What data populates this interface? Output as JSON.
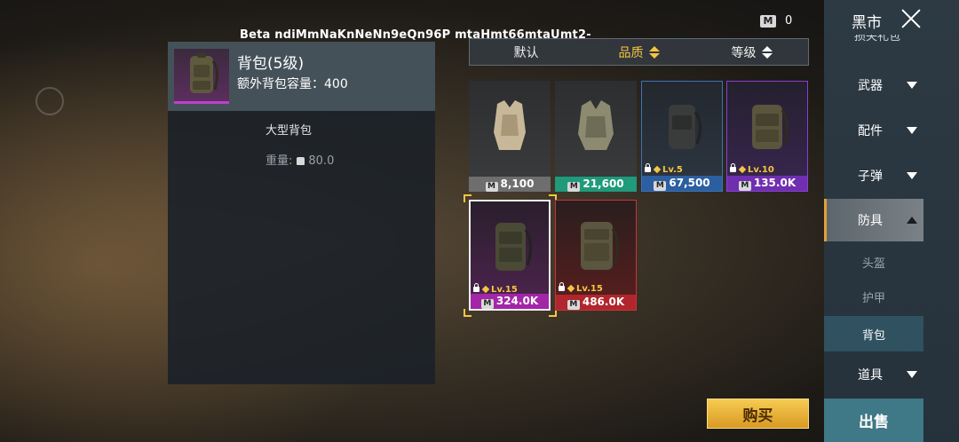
{
  "overlay": {
    "beta_text": "Beta ndiMmNaKnNeNn9eQn96P mtaHmt66mtaUmt2-"
  },
  "currency": {
    "icon": "m-coin-icon",
    "icon_text": "M",
    "value": "0"
  },
  "detail": {
    "name": "背包(5级)",
    "capacity": "额外背包容量：400",
    "type": "大型背包",
    "weight_label": "重量:",
    "weight_value": "80.0"
  },
  "sort": {
    "options": [
      {
        "label": "默认",
        "active": false
      },
      {
        "label": "品质",
        "active": true
      },
      {
        "label": "等级",
        "active": false
      }
    ]
  },
  "items": [
    {
      "price": "8,100",
      "rarity": "grey",
      "level": ""
    },
    {
      "price": "21,600",
      "rarity": "green",
      "level": ""
    },
    {
      "price": "67,500",
      "rarity": "blue",
      "level": "Lv.5"
    },
    {
      "price": "135.0K",
      "rarity": "purple",
      "level": "Lv.10"
    },
    {
      "price": "324.0K",
      "rarity": "magenta",
      "level": "Lv.15",
      "selected": true
    },
    {
      "price": "486.0K",
      "rarity": "red",
      "level": "Lv.15"
    }
  ],
  "sidebar": {
    "title": "黑市",
    "cut_item": "损失礼包",
    "categories": [
      {
        "label": "武器"
      },
      {
        "label": "配件"
      },
      {
        "label": "子弹"
      },
      {
        "label": "防具"
      },
      {
        "label": "道具"
      }
    ],
    "subitems": [
      {
        "label": "头盔"
      },
      {
        "label": "护甲"
      },
      {
        "label": "背包"
      }
    ],
    "sell_label": "出售"
  },
  "buy_label": "购买",
  "colors": {
    "accent_gold": "#f5c542",
    "rarity_grey": "#6e6e6e",
    "rarity_green": "#1f9a7a",
    "rarity_blue": "#2b5fa0",
    "rarity_purple": "#6f2fb0",
    "rarity_magenta": "#a426a8",
    "rarity_red": "#b0262c"
  }
}
